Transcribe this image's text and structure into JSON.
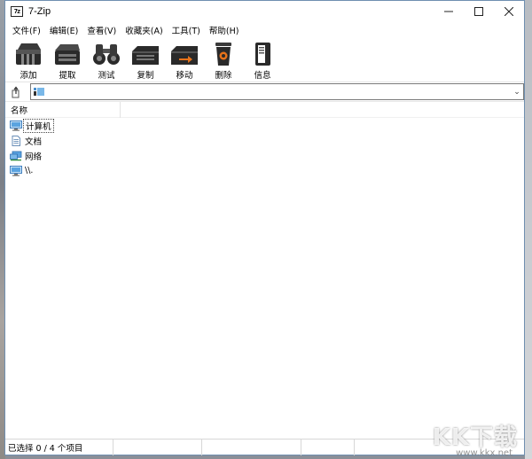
{
  "window": {
    "title": "7-Zip",
    "icon_text": "7z",
    "controls": {
      "minimize": "—",
      "maximize": "☐",
      "close": "✕"
    }
  },
  "menu": [
    "文件(F)",
    "编辑(E)",
    "查看(V)",
    "收藏夹(A)",
    "工具(T)",
    "帮助(H)"
  ],
  "toolbar": [
    {
      "label": "添加",
      "icon": "add-archive-icon"
    },
    {
      "label": "提取",
      "icon": "extract-icon"
    },
    {
      "label": "测试",
      "icon": "test-binoculars-icon"
    },
    {
      "label": "复制",
      "icon": "copy-icon"
    },
    {
      "label": "移动",
      "icon": "move-icon"
    },
    {
      "label": "删除",
      "icon": "delete-icon"
    },
    {
      "label": "信息",
      "icon": "info-icon"
    }
  ],
  "address": {
    "value": ""
  },
  "list": {
    "columns": [
      "名称"
    ],
    "items": [
      {
        "label": "计算机",
        "icon": "computer-icon"
      },
      {
        "label": "文档",
        "icon": "document-icon"
      },
      {
        "label": "网络",
        "icon": "network-icon"
      },
      {
        "label": "\\\\.",
        "icon": "computer-icon"
      }
    ]
  },
  "status": {
    "text": "已选择 0 / 4 个项目"
  },
  "watermark": {
    "logo": "KK下载",
    "url": "www.kkx.net"
  },
  "colors": {
    "window_border": "#6f8fb0",
    "accent_orange": "#e8731a"
  }
}
